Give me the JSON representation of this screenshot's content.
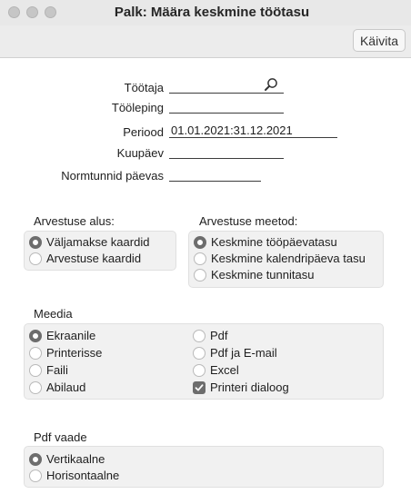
{
  "window": {
    "title": "Palk: Määra keskmine töötasu"
  },
  "toolbar": {
    "run_label": "Käivita"
  },
  "fields": [
    {
      "label": "Töötaja",
      "value": ""
    },
    {
      "label": "Tööleping",
      "value": ""
    },
    {
      "label": "Periood",
      "value": "01.01.2021:31.12.2021"
    },
    {
      "label": "Kuupäev",
      "value": ""
    },
    {
      "label": "Normtunnid päevas",
      "value": ""
    }
  ],
  "basis": {
    "title": "Arvestuse alus:",
    "options": [
      "Väljamakse kaardid",
      "Arvestuse kaardid"
    ],
    "selected": 0
  },
  "method": {
    "title": "Arvestuse meetod:",
    "options": [
      "Keskmine tööpäevatasu",
      "Keskmine kalendripäeva tasu",
      "Keskmine tunnitasu"
    ],
    "selected": 0
  },
  "media": {
    "title": "Meedia",
    "left": [
      "Ekraanile",
      "Printerisse",
      "Faili",
      "Abilaud"
    ],
    "right": [
      "Pdf",
      "Pdf ja E-mail",
      "Excel",
      "Printeri dialoog"
    ],
    "selected": "Ekraanile",
    "printer_dialog_checked": true
  },
  "pdf_view": {
    "title": "Pdf vaade",
    "options": [
      "Vertikaalne",
      "Horisontaalne"
    ],
    "selected": 0
  },
  "icons": {
    "employee_lookup": "magnifier-icon",
    "checkbox_checked": "checkmark-icon"
  }
}
